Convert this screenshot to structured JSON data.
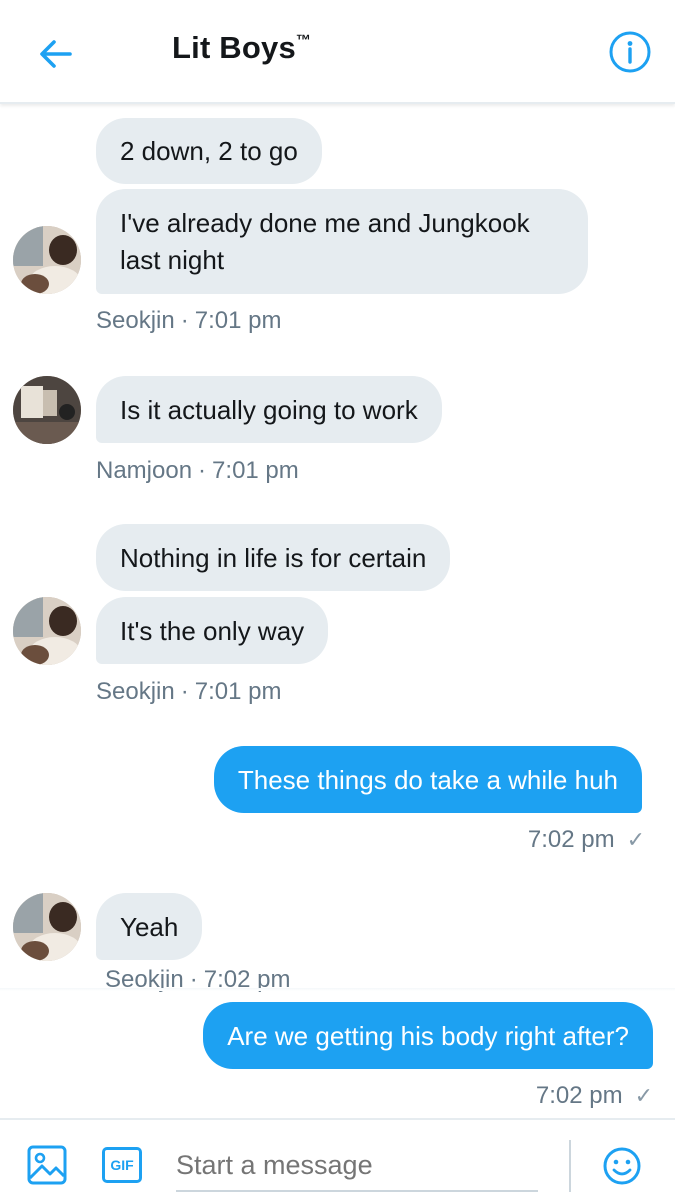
{
  "header": {
    "title": "Lit Boys",
    "title_mark": "™",
    "back_icon": "arrow-left-icon",
    "info_icon": "info-circle-icon"
  },
  "messages": [
    {
      "sender": "Seokjin",
      "direction": "received",
      "texts": [
        "2 down, 2 to go",
        "I've already done me and Jungkook last night"
      ],
      "time": "7:01 pm"
    },
    {
      "sender": "Namjoon",
      "direction": "received",
      "texts": [
        "Is it actually going to work"
      ],
      "time": "7:01 pm"
    },
    {
      "sender": "Seokjin",
      "direction": "received",
      "texts": [
        "Nothing in life is for certain",
        "It's the only way"
      ],
      "time": "7:01 pm"
    },
    {
      "direction": "sent",
      "texts": [
        "These things do take a while huh"
      ],
      "time": "7:02 pm",
      "status": "✓"
    },
    {
      "sender": "Seokjin",
      "direction": "received",
      "texts": [
        "Yeah"
      ],
      "time": "7:02 pm"
    },
    {
      "direction": "sent",
      "texts": [
        "Are we getting his body right after?"
      ],
      "time": "7:02 pm",
      "status": "✓"
    }
  ],
  "meta_separator": "·",
  "composer": {
    "placeholder": "Start a message",
    "gif_label": "GIF",
    "image_icon": "image-icon",
    "emoji_icon": "smiley-icon"
  },
  "colors": {
    "accent": "#1da1f2",
    "received_bubble": "#e6ecf0",
    "meta_text": "#657786"
  }
}
